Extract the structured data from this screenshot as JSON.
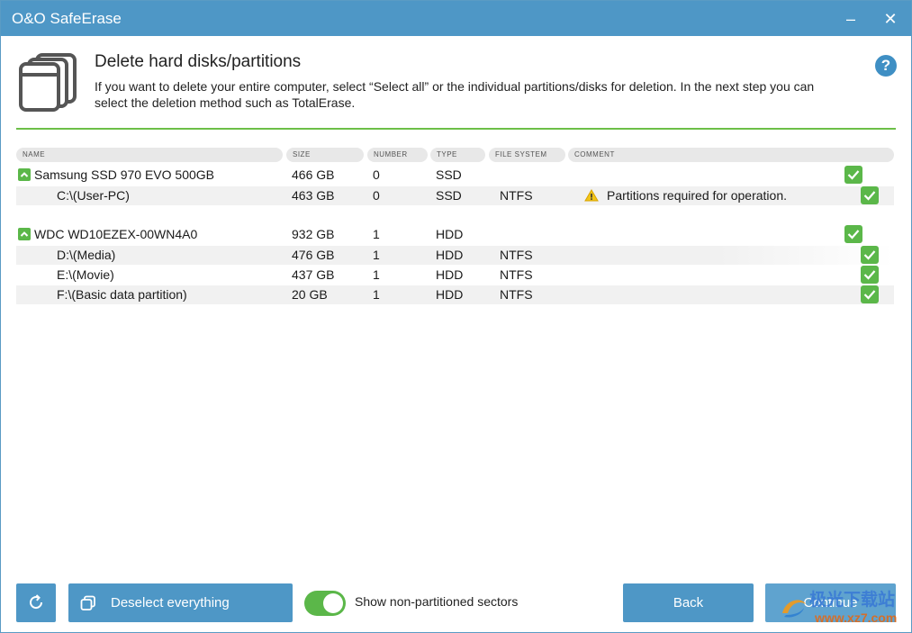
{
  "window": {
    "title": "O&O SafeErase",
    "minimize": "–",
    "close": "✕"
  },
  "header": {
    "title": "Delete hard disks/partitions",
    "description": "If you want to delete your entire computer, select “Select all” or the individual partitions/disks for deletion. In the next step you can select the deletion method such as TotalErase.",
    "help": "?"
  },
  "columns": [
    "NAME",
    "SIZE",
    "NUMBER",
    "TYPE",
    "FILE SYSTEM",
    "COMMENT"
  ],
  "disks": [
    {
      "name": "Samsung SSD 970 EVO 500GB",
      "size": "466 GB",
      "number": "0",
      "type": "SSD",
      "checked": true,
      "partitions": [
        {
          "name": "C:\\(User-PC)",
          "size": "463 GB",
          "number": "0",
          "type": "SSD",
          "fs": "NTFS",
          "comment": "Partitions required for operation.",
          "checked": true
        }
      ]
    },
    {
      "name": "WDC WD10EZEX-00WN4A0",
      "size": "932 GB",
      "number": "1",
      "type": "HDD",
      "checked": true,
      "partitions": [
        {
          "name": "D:\\(Media)",
          "size": "476 GB",
          "number": "1",
          "type": "HDD",
          "fs": "NTFS",
          "comment": "",
          "checked": true
        },
        {
          "name": "E:\\(Movie)",
          "size": "437 GB",
          "number": "1",
          "type": "HDD",
          "fs": "NTFS",
          "comment": "",
          "checked": true
        },
        {
          "name": "F:\\(Basic data partition)",
          "size": "20 GB",
          "number": "1",
          "type": "HDD",
          "fs": "NTFS",
          "comment": "",
          "checked": true
        }
      ]
    }
  ],
  "footer": {
    "deselect_label": "Deselect everything",
    "toggle_label": "Show non-partitioned sectors",
    "toggle_on": true,
    "back_label": "Back",
    "continue_label": "Continue"
  },
  "watermark": {
    "text": "极光下载站",
    "url": "www.xz7.com"
  },
  "colors": {
    "accent": "#4e97c6",
    "green": "#5bb749",
    "rule": "#6cbf48"
  }
}
